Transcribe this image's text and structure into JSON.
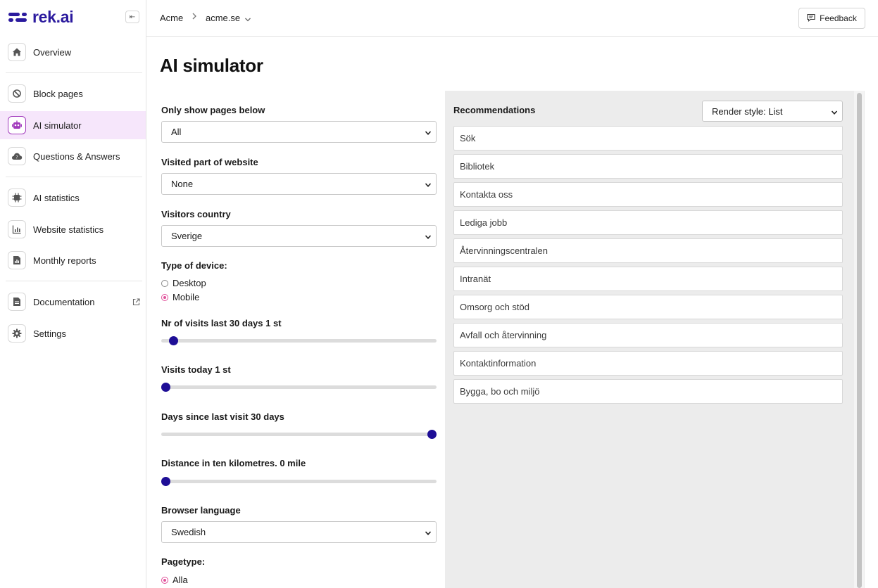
{
  "app": {
    "logo_text": "rek.ai",
    "logo_color": "#2b1a9e",
    "accent": "#a23bbd"
  },
  "sidebar": {
    "collapse_icon": "collapse-left-icon",
    "items": [
      {
        "label": "Overview",
        "icon": "home-icon"
      },
      {
        "label": "Block pages",
        "icon": "block-icon"
      },
      {
        "label": "AI simulator",
        "icon": "robot-icon",
        "active": true
      },
      {
        "label": "Questions & Answers",
        "icon": "cloud-question-icon"
      },
      {
        "label": "AI statistics",
        "icon": "chip-icon"
      },
      {
        "label": "Website statistics",
        "icon": "bar-chart-icon"
      },
      {
        "label": "Monthly reports",
        "icon": "report-icon"
      },
      {
        "label": "Documentation",
        "icon": "document-icon",
        "external": true
      },
      {
        "label": "Settings",
        "icon": "gear-icon"
      }
    ]
  },
  "header": {
    "breadcrumb": [
      "Acme",
      "acme.se"
    ],
    "feedback_label": "Feedback"
  },
  "main": {
    "title": "AI simulator",
    "form": {
      "pages_below": {
        "label": "Only show pages below",
        "value": "All"
      },
      "visited_part": {
        "label": "Visited part of website",
        "value": "None"
      },
      "country": {
        "label": "Visitors country",
        "value": "Sverige"
      },
      "device": {
        "label": "Type of device:",
        "options": [
          "Desktop",
          "Mobile"
        ],
        "selected": "Mobile"
      },
      "visits_30": {
        "label": "Nr of visits last 30 days 1 st",
        "level": 0.03
      },
      "visits_today": {
        "label": "Visits today 1 st",
        "level": 0.0
      },
      "days_since": {
        "label": "Days since last visit 30 days",
        "level": 1.0
      },
      "distance": {
        "label": "Distance in ten kilometres. 0 mile",
        "level": 0.0
      },
      "browser_language": {
        "label": "Browser language",
        "value": "Swedish"
      },
      "pagetype": {
        "label": "Pagetype:",
        "options": [
          "Alla"
        ],
        "selected": "Alla"
      }
    },
    "recommendations": {
      "title": "Recommendations",
      "render_style": "Render style: List",
      "items": [
        "Sök",
        "Bibliotek",
        "Kontakta oss",
        "Lediga jobb",
        "Återvinningscentralen",
        "Intranät",
        "Omsorg och stöd",
        "Avfall och återvinning",
        "Kontaktinformation",
        "Bygga, bo och miljö"
      ]
    }
  }
}
